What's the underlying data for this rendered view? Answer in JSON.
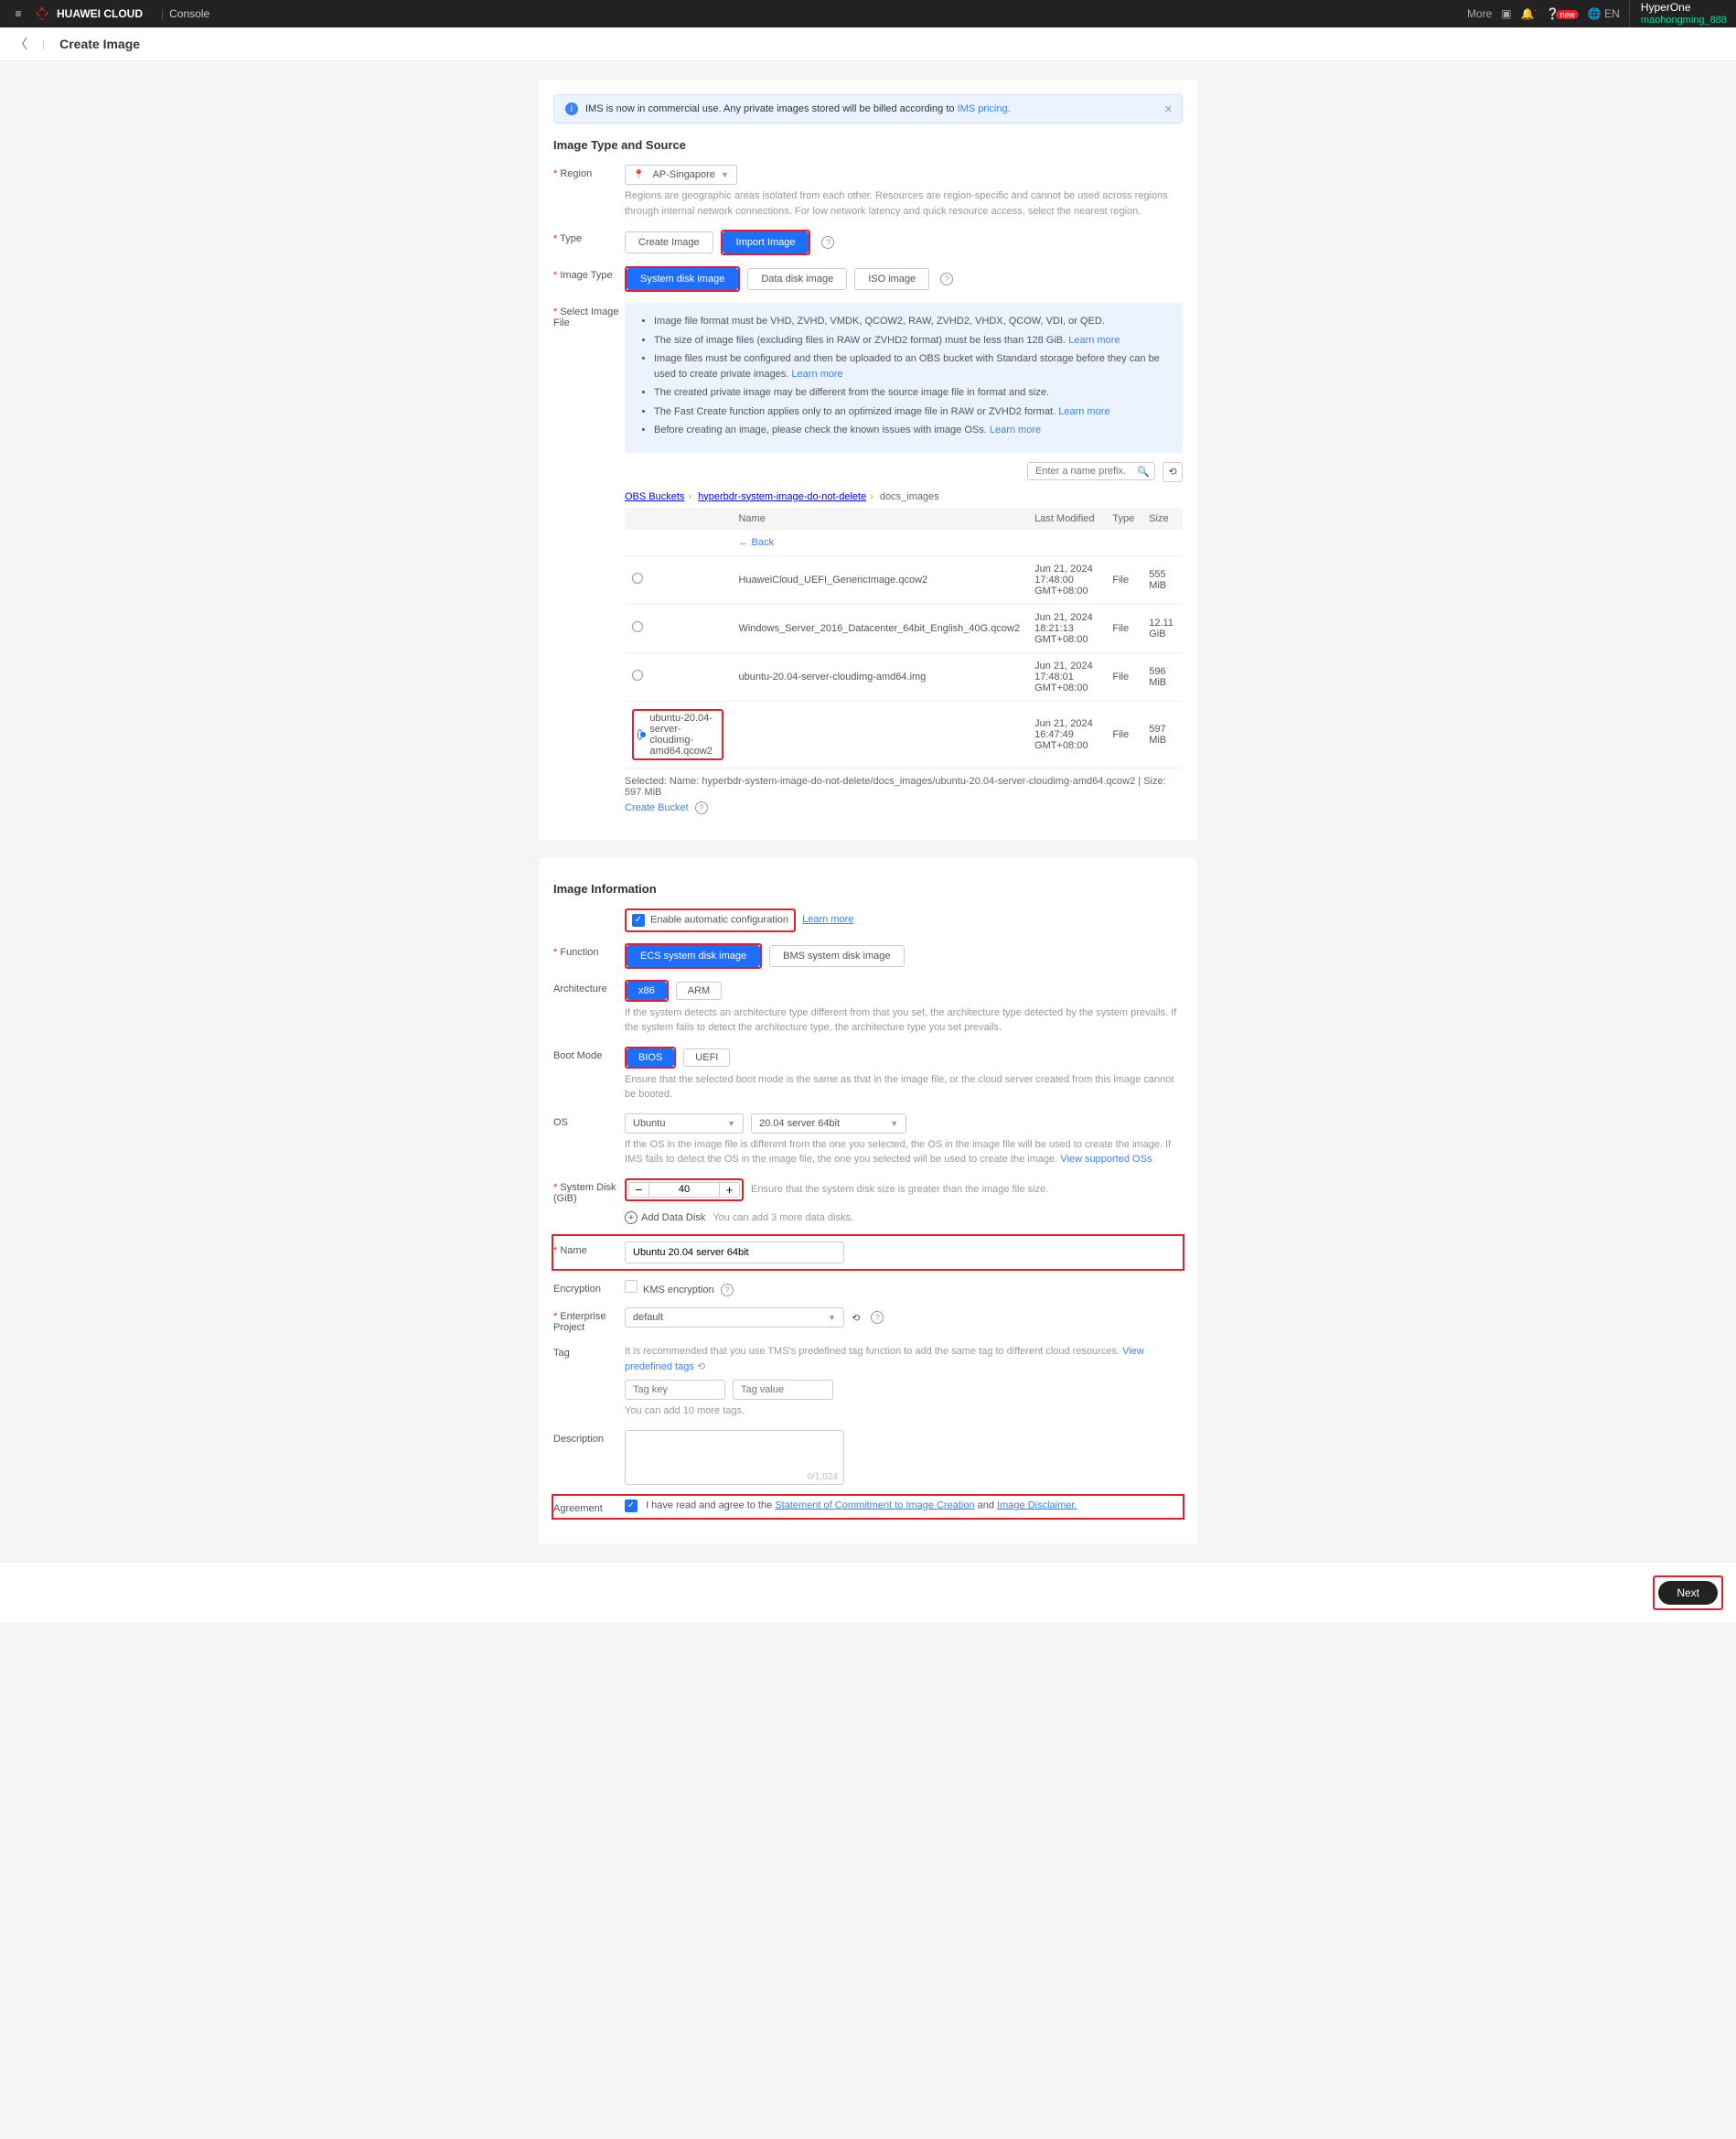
{
  "header": {
    "brand": "HUAWEI CLOUD",
    "console": "Console",
    "more": "More",
    "lang": "EN",
    "user_line1": "HyperOne",
    "user_line2": "maohongming_888"
  },
  "page": {
    "title": "Create Image",
    "banner_text": "IMS is now in commercial use. Any private images stored will be billed according to ",
    "banner_link": "IMS pricing."
  },
  "section1": {
    "title": "Image Type and Source",
    "region_label": "Region",
    "region_value": "AP-Singapore",
    "region_help": "Regions are geographic areas isolated from each other. Resources are region-specific and cannot be used across regions through internal network connections. For low network latency and quick resource access, select the nearest region.",
    "type_label": "Type",
    "type_create": "Create Image",
    "type_import": "Import Image",
    "image_type_label": "Image Type",
    "image_type_system": "System disk image",
    "image_type_data": "Data disk image",
    "image_type_iso": "ISO image",
    "select_file_label": "Select Image File",
    "bullets": [
      "Image file format must be VHD, ZVHD, VMDK, QCOW2, RAW, ZVHD2, VHDX, QCOW, VDI, or QED.",
      "The size of image files (excluding files in RAW or ZVHD2 format) must be less than 128 GiB. ",
      "Image files must be configured and then be uploaded to an OBS bucket with Standard storage before they can be used to create private images. ",
      "The created private image may be different from the source image file in format and size.",
      "The Fast Create function applies only to an optimized image file in RAW or ZVHD2 format. ",
      "Before creating an image, please check the known issues with image OSs. "
    ],
    "learn_more": "Learn more",
    "search_placeholder": "Enter a name prefix.",
    "breadcrumb": {
      "a": "OBS Buckets",
      "b": "hyperbdr-system-image-do-not-delete",
      "c": "docs_images"
    },
    "table": {
      "headers": {
        "name": "Name",
        "modified": "Last Modified",
        "type": "Type",
        "size": "Size"
      },
      "back": "Back",
      "rows": [
        {
          "name": "HuaweiCloud_UEFI_GenericImage.qcow2",
          "modified": "Jun 21, 2024 17:48:00 GMT+08:00",
          "type": "File",
          "size": "555 MiB",
          "checked": false
        },
        {
          "name": "Windows_Server_2016_Datacenter_64bit_English_40G.qcow2",
          "modified": "Jun 21, 2024 18:21:13 GMT+08:00",
          "type": "File",
          "size": "12.11 GiB",
          "checked": false
        },
        {
          "name": "ubuntu-20.04-server-cloudimg-amd64.img",
          "modified": "Jun 21, 2024 17:48:01 GMT+08:00",
          "type": "File",
          "size": "596 MiB",
          "checked": false
        },
        {
          "name": "ubuntu-20.04-server-cloudimg-amd64.qcow2",
          "modified": "Jun 21, 2024 16:47:49 GMT+08:00",
          "type": "File",
          "size": "597 MiB",
          "checked": true
        }
      ],
      "selected": "Selected: Name:  hyperbdr-system-image-do-not-delete/docs_images/ubuntu-20.04-server-cloudimg-amd64.qcow2 | Size: 597 MiB",
      "create_bucket": "Create Bucket"
    }
  },
  "section2": {
    "title": "Image Information",
    "auto_config": "Enable automatic configuration",
    "auto_config_link": "Learn more",
    "function_label": "Function",
    "function_ecs": "ECS system disk image",
    "function_bms": "BMS system disk image",
    "arch_label": "Architecture",
    "arch_x86": "x86",
    "arch_arm": "ARM",
    "arch_help": "If the system detects an architecture type different from that you set, the architecture type detected by the system prevails. If the system fails to detect the architecture type, the architecture type you set prevails.",
    "boot_label": "Boot Mode",
    "boot_bios": "BIOS",
    "boot_uefi": "UEFI",
    "boot_help": "Ensure that the selected boot mode is the same as that in the image file, or the cloud server created from this image cannot be booted.",
    "os_label": "OS",
    "os_family": "Ubuntu",
    "os_version": "20.04 server 64bit",
    "os_help": "If the OS in the image file is different from the one you selected, the OS in the image file will be used to create the image. If IMS fails to detect the OS in the image file, the one you selected will be used to create the image. ",
    "os_help_link": "View supported OSs",
    "disk_label": "System Disk (GiB)",
    "disk_value": "40",
    "disk_help": "Ensure that the system disk size is greater than the image file size.",
    "add_disk": "Add Data Disk",
    "add_disk_help": "You can add 3 more data disks.",
    "name_label": "Name",
    "name_value": "Ubuntu 20.04 server 64bit",
    "enc_label": "Encryption",
    "enc_kms": "KMS encryption",
    "ep_label": "Enterprise Project",
    "ep_value": "default",
    "tag_label": "Tag",
    "tag_help": "It is recommended that you use TMS's predefined tag function to add the same tag to different cloud resources. ",
    "tag_link": "View predefined tags",
    "tag_key": "Tag key",
    "tag_value": "Tag value",
    "tag_count": "You can add 10 more tags.",
    "desc_label": "Description",
    "desc_count": "0/1,024",
    "agree_label": "Agreement",
    "agree_text": "I have read and agree to the ",
    "agree_link1": "Statement of Commitment to Image Creation",
    "agree_and": " and ",
    "agree_link2": "Image Disclaimer."
  },
  "footer": {
    "next": "Next"
  }
}
